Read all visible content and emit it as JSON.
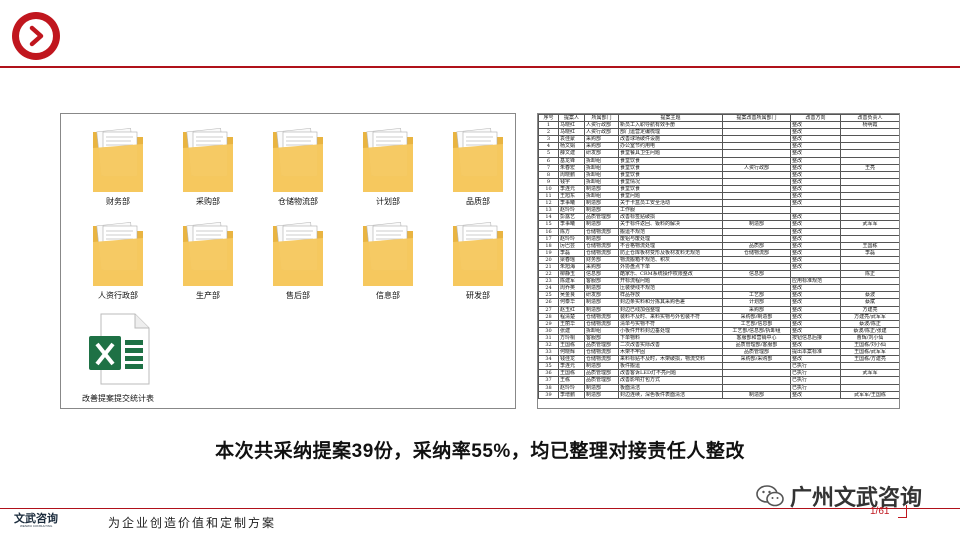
{
  "colors": {
    "accent": "#c0161e",
    "folder": "#f6c85f",
    "excel": "#1e7145"
  },
  "folders": [
    {
      "label": "财务部",
      "icon": "folder-icon"
    },
    {
      "label": "采购部",
      "icon": "folder-icon"
    },
    {
      "label": "仓储物流部",
      "icon": "folder-icon"
    },
    {
      "label": "计划部",
      "icon": "folder-icon"
    },
    {
      "label": "品质部",
      "icon": "folder-icon"
    },
    {
      "label": "人资行政部",
      "icon": "folder-icon"
    },
    {
      "label": "生产部",
      "icon": "folder-icon"
    },
    {
      "label": "售后部",
      "icon": "folder-icon"
    },
    {
      "label": "信息部",
      "icon": "folder-icon"
    },
    {
      "label": "研发部",
      "icon": "folder-icon"
    }
  ],
  "excel_file": {
    "label": "改善提案提交统计表",
    "icon": "excel-icon"
  },
  "table": {
    "headers": [
      "序号",
      "提案人",
      "所属部门",
      "提案主题",
      "提案改善所属部门",
      "改善方向",
      "改善负责人"
    ],
    "rows": [
      [
        "1",
        "马晓红",
        "人资行政部",
        "新员工入职导航有效手册",
        "",
        "整改",
        "杨明霞"
      ],
      [
        "2",
        "马晓红",
        "人资行政部",
        "部门运营定编梳理",
        "",
        "整改",
        ""
      ],
      [
        "3",
        "袁佳蒙",
        "采购部",
        "改善球场破件设施",
        "",
        "整改",
        ""
      ],
      [
        "4",
        "杨文娟",
        "采购部",
        "办公室节约用电",
        "",
        "整改",
        ""
      ],
      [
        "5",
        "薛文建",
        "研发部",
        "食堂餐具卫生问题",
        "",
        "整改",
        ""
      ],
      [
        "6",
        "基龙锋",
        "拆卸组",
        "食堂饮食",
        "",
        "整改",
        ""
      ],
      [
        "7",
        "朱春宏",
        "拆卸组",
        "食堂饮食",
        "人资行政部",
        "整改",
        "王亮"
      ],
      [
        "8",
        "周晓鹏",
        "拆卸组",
        "食堂饮食",
        "",
        "整改",
        ""
      ],
      [
        "9",
        "钱宇",
        "拆卸组",
        "食堂情况",
        "",
        "整改",
        ""
      ],
      [
        "10",
        "李连元",
        "制造部",
        "食堂饮食",
        "",
        "整改",
        ""
      ],
      [
        "11",
        "王旭东",
        "拆卸组",
        "食堂问题",
        "",
        "整改",
        ""
      ],
      [
        "12",
        "李事曦",
        "制造部",
        "关于卡盒员工安全活动",
        "",
        "整改",
        ""
      ],
      [
        "13",
        "赵玲玲",
        "制造部",
        "工作服",
        "",
        "",
        ""
      ],
      [
        "14",
        "彭露艺",
        "品质管理部",
        "改善标签贴破损",
        "",
        "整改",
        ""
      ],
      [
        "15",
        "李事曦",
        "制造部",
        "关于标件返回、钣料的解决",
        "制造部",
        "整改",
        "武军军"
      ],
      [
        "16",
        "陈方",
        "仓储物流部",
        "搬运不规范",
        "",
        "整改",
        ""
      ],
      [
        "17",
        "赵玲玲",
        "制造部",
        "废铝与废处理",
        "",
        "整改",
        ""
      ],
      [
        "18",
        "厉巴芸",
        "仓储物流部",
        "不合格物流处理",
        "品质部",
        "整改",
        "王国栋"
      ],
      [
        "19",
        "李磊",
        "仓储物流部",
        "防止仓库板材变形及板材发料无规范",
        "仓储物流部",
        "整改",
        "李磊"
      ],
      [
        "20",
        "梁春瑶",
        "财务部",
        "物流搬箱不规范、积灰",
        "",
        "整改",
        ""
      ],
      [
        "21",
        "朱旭海",
        "采购部",
        "外协盘点下单",
        "",
        "整改",
        ""
      ],
      [
        "22",
        "柳静玉",
        "信息部",
        "酷家乐、CRM系统操作权限整改",
        "信息部",
        "",
        "陈正"
      ],
      [
        "23",
        "陈建军",
        "客服部",
        "开标流程问题",
        "",
        "应用标准规范",
        ""
      ],
      [
        "24",
        "周乔英",
        "制造部",
        "压装使线不规范",
        "",
        "整改",
        ""
      ],
      [
        "25",
        "吴金良",
        "研发部",
        "样品存放",
        "工艺部",
        "整改",
        "蔡波"
      ],
      [
        "26",
        "何泰华",
        "制造部",
        "封边条实料和分拣其采购色差",
        "计划部",
        "整改",
        "蔡斌"
      ],
      [
        "27",
        "赵玉红",
        "制造部",
        "封边已线加强整理",
        "采购部",
        "整改",
        "方建亮"
      ],
      [
        "28",
        "程清楚",
        "仓储物流部",
        "装料不及时、来料实物与外包装不符",
        "采购部/制造部",
        "整改",
        "方建亮/武军军"
      ],
      [
        "29",
        "王丽华",
        "仓储物流部",
        "清单与实物不符",
        "工艺部/信息部",
        "整改",
        "蔡波/陈正"
      ],
      [
        "30",
        "张建",
        "拆卸组",
        "小板件开料封边垂处理",
        "工艺部/信息部/拆卸组",
        "整改",
        "蔡波/陈正/张建"
      ],
      [
        "31",
        "方玲桐",
        "客服部",
        "下单物料",
        "客服部和营销中心",
        "按钮信息后接",
        "曹辉/刘小仙"
      ],
      [
        "32",
        "王国栋",
        "品质管理部",
        "二次改善实际改善",
        "品质管理部/客服部",
        "整改",
        "王国栋/刘小仙"
      ],
      [
        "33",
        "何晓辉",
        "仓储物流部",
        "木架不牢固",
        "品质管理部",
        "提出本案标准",
        "王国栋/武军军"
      ],
      [
        "34",
        "钱佳龙",
        "仓储物流部",
        "来料标贴不及时，木架破损，物流交料",
        "采购部/采购部",
        "整改",
        "王国栋/方建亮"
      ],
      [
        "35",
        "李连元",
        "制造部",
        "板件搬运",
        "",
        "已执行",
        ""
      ],
      [
        "36",
        "王国栋",
        "品质管理部",
        "改善客诉LED灯不亮问题",
        "",
        "已执行",
        "武军军"
      ],
      [
        "37",
        "王栋",
        "品质管理部",
        "改善影响打包方式",
        "",
        "已执行",
        ""
      ],
      [
        "38",
        "赵玲玲",
        "制造部",
        "板面清洁",
        "",
        "已执行",
        ""
      ],
      [
        "39",
        "李增鹏",
        "制造部",
        "封边连续，深色板件表面清洁",
        "制造部",
        "整改",
        "武军军/王国栋"
      ]
    ]
  },
  "headline": "本次共采纳提案39份，采纳率55%，均已整理对接责任人整改",
  "footer": {
    "brand": "文武咨询",
    "brand_sub": "WENWU CONSULTING",
    "tagline": "为企业创造价值和定制方案",
    "page": "1/61"
  },
  "watermark": {
    "text": "广州文武咨询",
    "icon": "wechat-icon"
  }
}
